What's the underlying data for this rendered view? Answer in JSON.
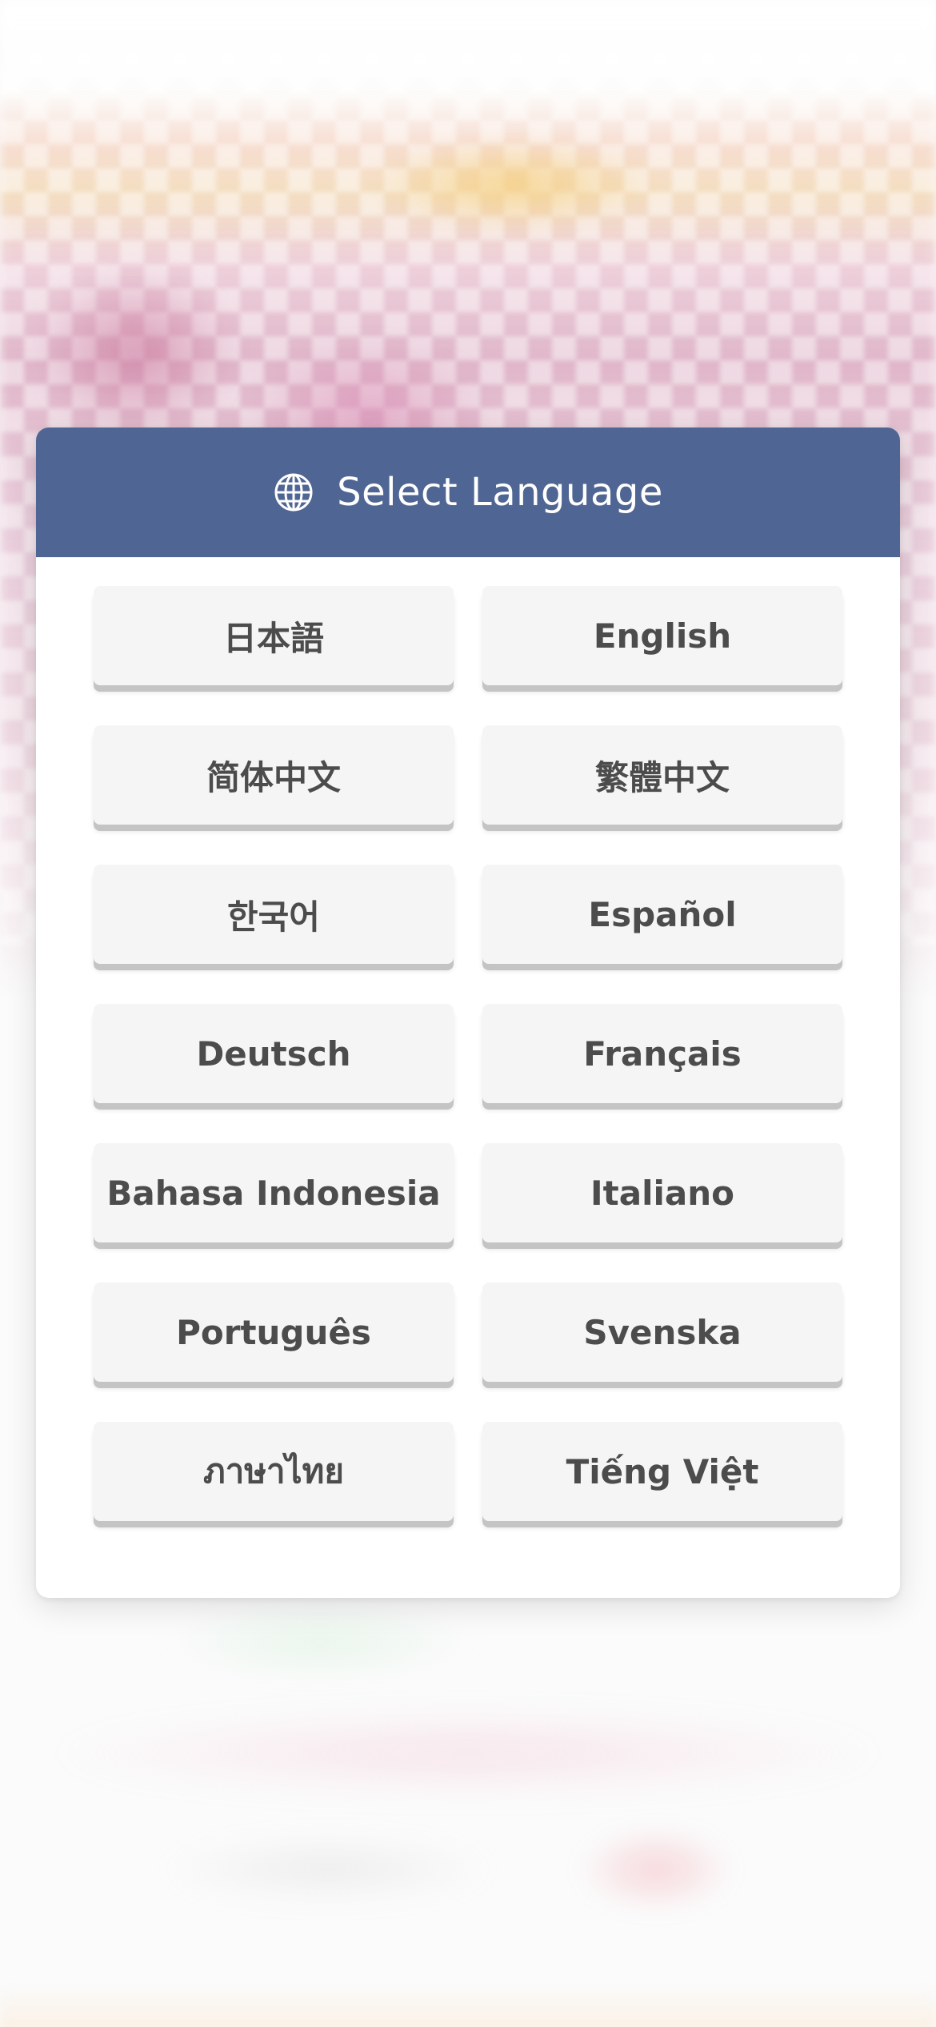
{
  "modal": {
    "title": "Select Language",
    "icon": "globe-icon",
    "header_color": "#4f6593"
  },
  "languages": [
    {
      "label": "日本語"
    },
    {
      "label": "English"
    },
    {
      "label": "简体中文"
    },
    {
      "label": "繁體中文"
    },
    {
      "label": "한국어"
    },
    {
      "label": "Español"
    },
    {
      "label": "Deutsch"
    },
    {
      "label": "Français"
    },
    {
      "label": "Bahasa Indonesia"
    },
    {
      "label": "Italiano"
    },
    {
      "label": "Português"
    },
    {
      "label": "Svenska"
    },
    {
      "label": "ภาษาไทย"
    },
    {
      "label": "Tiếng Việt"
    }
  ]
}
